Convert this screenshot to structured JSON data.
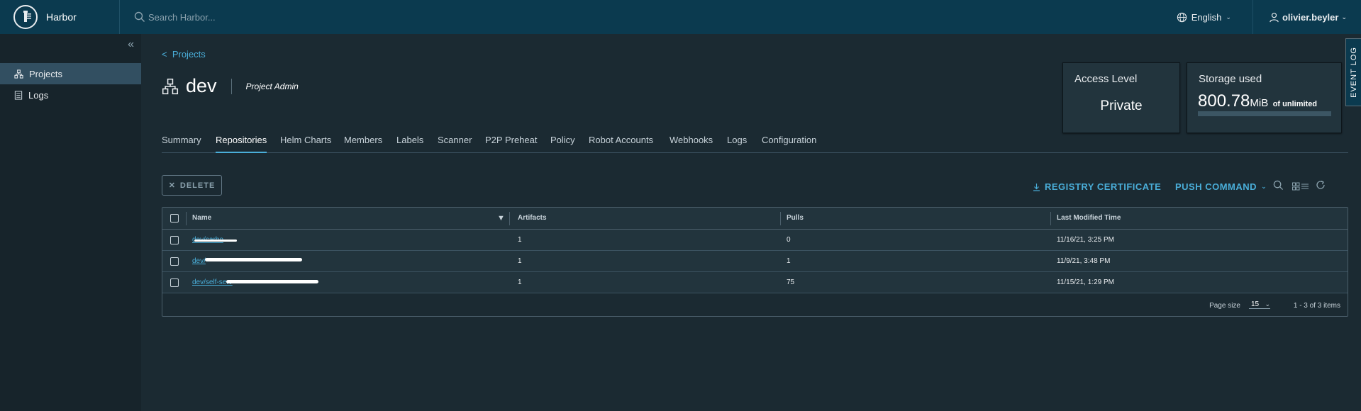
{
  "header": {
    "brand": "Harbor",
    "search_placeholder": "Search Harbor...",
    "language": "English",
    "user": "olivier.beyler"
  },
  "sidebar": {
    "items": [
      {
        "label": "Projects",
        "icon": "projects-icon",
        "active": true
      },
      {
        "label": "Logs",
        "icon": "logs-icon",
        "active": false
      }
    ]
  },
  "project": {
    "back_label": "Projects",
    "name": "dev",
    "role": "Project Admin"
  },
  "cards": {
    "access": {
      "title": "Access Level",
      "value": "Private"
    },
    "storage": {
      "title": "Storage used",
      "value": "800.78",
      "unit": "MiB",
      "suffix": "of unlimited",
      "usage_fraction": 0
    }
  },
  "event_log": "EVENT LOG",
  "tabs": [
    "Summary",
    "Repositories",
    "Helm Charts",
    "Members",
    "Labels",
    "Scanner",
    "P2P Preheat",
    "Policy",
    "Robot Accounts",
    "Webhooks",
    "Logs",
    "Configuration"
  ],
  "active_tab": "Repositories",
  "toolbar": {
    "delete": "DELETE",
    "registry_certificate": "REGISTRY CERTIFICATE",
    "push_command": "PUSH COMMAND"
  },
  "table": {
    "columns": [
      "Name",
      "Artifacts",
      "Pulls",
      "Last Modified Time"
    ],
    "rows": [
      {
        "name": "dev/carbo",
        "artifacts": "1",
        "pulls": "0",
        "modified": "11/16/21, 3:25 PM"
      },
      {
        "name": "dev/",
        "artifacts": "1",
        "pulls": "1",
        "modified": "11/9/21, 3:48 PM"
      },
      {
        "name": "dev/self-serv",
        "artifacts": "1",
        "pulls": "75",
        "modified": "11/15/21, 1:29 PM"
      }
    ],
    "footer": {
      "page_size_label": "Page size",
      "page_size": "15",
      "summary": "1 - 3 of 3 items"
    }
  },
  "colors": {
    "header_bg": "#0b3a4f",
    "sidebar_bg": "#17242b",
    "main_bg": "#1b2a32",
    "accent": "#4aaed9"
  }
}
